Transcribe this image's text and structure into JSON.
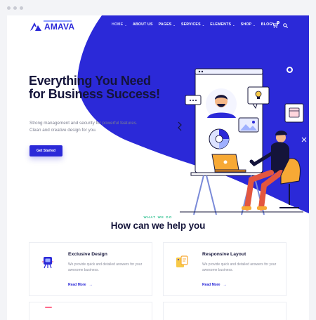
{
  "brand": {
    "name": "AMAVA",
    "color": "#2b29d8"
  },
  "nav": {
    "items": [
      {
        "label": "HOME",
        "active": true,
        "has_dropdown": true
      },
      {
        "label": "ABOUT US",
        "active": false,
        "has_dropdown": false
      },
      {
        "label": "PAGES",
        "active": false,
        "has_dropdown": true
      },
      {
        "label": "SERVICES",
        "active": false,
        "has_dropdown": true
      },
      {
        "label": "ELEMENTS",
        "active": false,
        "has_dropdown": true
      },
      {
        "label": "SHOP",
        "active": false,
        "has_dropdown": true
      },
      {
        "label": "BLOG",
        "active": false,
        "has_dropdown": true
      }
    ],
    "cart_icon": "cart-icon",
    "cart_count": "0",
    "search_icon": "search-icon"
  },
  "hero": {
    "title": "Everything You Need for Business Success!",
    "subtitle": "Strong management and security for powerful features. Clean and creative design for you.",
    "cta_label": "Get Started"
  },
  "section": {
    "eyebrow": "WHAT WE DO",
    "title": "How can we help you"
  },
  "cards": [
    {
      "title": "Exclusive Design",
      "text": "We provide quick and detailed answers for your awesome business.",
      "link": "Read More",
      "icon": "rocket-icon"
    },
    {
      "title": "Responsive Layout",
      "text": "We provide quick and detailed answers for your awesome business.",
      "link": "Read More",
      "icon": "devices-icon"
    }
  ],
  "colors": {
    "accent": "#2b29d8",
    "heading": "#14143a",
    "eyebrow": "#2bbf8d",
    "body_text": "#7a7d8f"
  }
}
